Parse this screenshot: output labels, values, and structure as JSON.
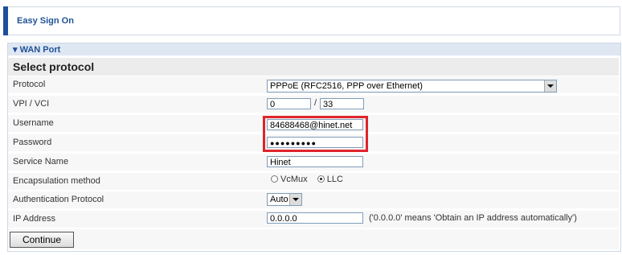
{
  "header": {
    "title": "Easy Sign On"
  },
  "panel": {
    "section_label": "▾ WAN Port",
    "heading": "Select protocol",
    "rows": [
      {
        "label": "Protocol"
      },
      {
        "label": "VPI / VCI"
      },
      {
        "label": "Username"
      },
      {
        "label": "Password"
      },
      {
        "label": "Service Name"
      },
      {
        "label": "Encapsulation method"
      },
      {
        "label": "Authentication Protocol"
      },
      {
        "label": "IP Address"
      }
    ],
    "protocol_value": "PPPoE (RFC2516, PPP over Ethernet)",
    "vpi": "0",
    "vci_sep": "/",
    "vci": "33",
    "username": "84688468@hinet.net",
    "password_mask": "●●●●●●●●●",
    "service_name": "Hinet",
    "encap_opt1": "VcMux",
    "encap_opt2": "LLC",
    "auth_value": "Auto",
    "ip_value": "0.0.0.0",
    "ip_note": "('0.0.0.0' means 'Obtain an IP address automatically')",
    "continue_label": "Continue"
  },
  "colors": {
    "accent": "#1c4f9c",
    "highlight": "#e0242b",
    "heading_text": "#1f5296"
  }
}
